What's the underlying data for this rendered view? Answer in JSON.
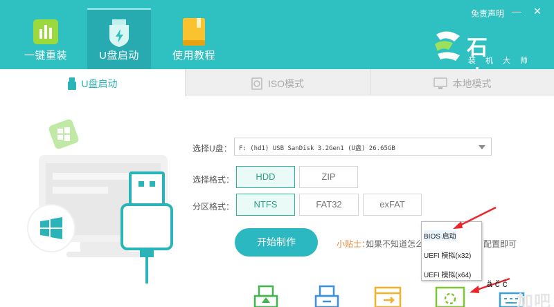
{
  "header": {
    "nav": [
      {
        "label": "一键重装",
        "icon": "chart-bars-icon"
      },
      {
        "label": "U盘启动",
        "icon": "usb-shield-icon"
      },
      {
        "label": "使用教程",
        "icon": "book-icon"
      }
    ],
    "disclaimer": "免责声明",
    "minimize": "—",
    "close": "✕",
    "brand_title": "石大师",
    "brand_sub": "装机大师"
  },
  "tabs": [
    {
      "label": "U盘启动",
      "icon": "usb-stick-icon"
    },
    {
      "label": "ISO模式",
      "icon": "disc-file-icon"
    },
    {
      "label": "本地模式",
      "icon": "monitor-icon"
    }
  ],
  "form": {
    "drive_label": "选择U盘：",
    "drive_value": "F: (hd1) USB SanDisk 3.2Gen1 (U盘) 26.65GB",
    "format_label": "选择格式：",
    "formats": [
      "HDD",
      "ZIP"
    ],
    "selected_format": "HDD",
    "partition_label": "分区格式：",
    "partitions": [
      "NTFS",
      "FAT32",
      "exFAT"
    ],
    "selected_partition": "NTFS",
    "start_button": "开始制作",
    "tip_label": "小贴士：",
    "tip_text": "如果不知道怎么",
    "tip_text_end": "配置即可"
  },
  "boot_popup": {
    "items": [
      "BIOS 启动",
      "UEFI 模拟(x32)",
      "UEFI 模拟(x64)"
    ]
  },
  "handwriting": "ä  č  c̈",
  "watermark": "加吧",
  "colors": {
    "header": "#2fc0c2",
    "accent": "#2bb4b8",
    "selected_green": "#2bb49a",
    "arrow_red": "#e8262c",
    "tip_orange": "#e08a3a"
  }
}
